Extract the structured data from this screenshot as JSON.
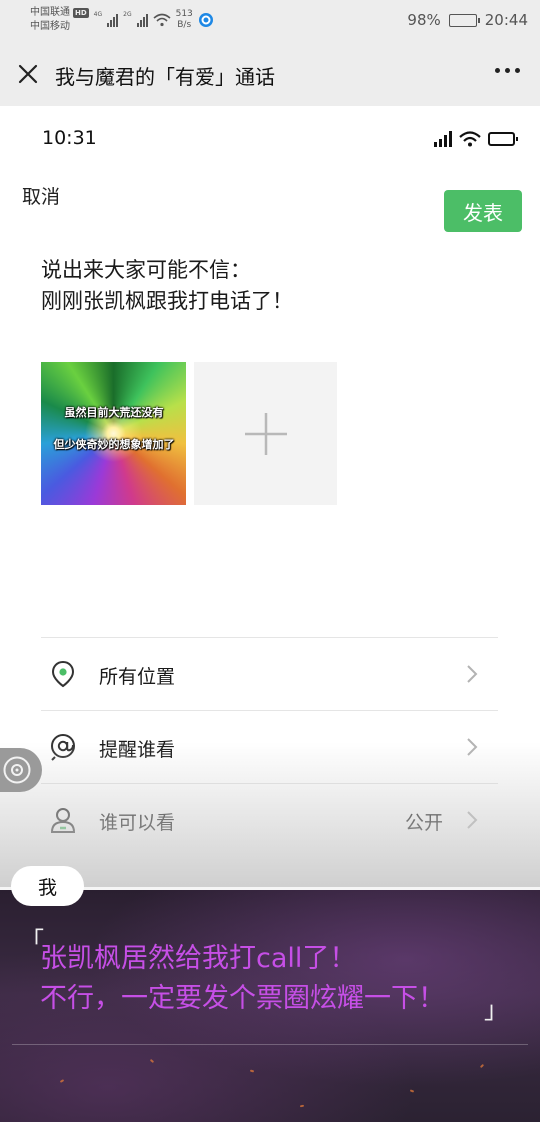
{
  "status_bar": {
    "carrier_1": "中国联通",
    "carrier_2": "中国移动",
    "hd_badge": "HD",
    "net_1": "4G",
    "net_2": "2G",
    "speed_value": "513",
    "speed_unit": "B/s",
    "battery": "98%",
    "battery_level": 0.98,
    "time": "20:44"
  },
  "app_bar": {
    "title": "我与魔君的「有爱」通话"
  },
  "inner_status": {
    "time": "10:31"
  },
  "composer": {
    "cancel": "取消",
    "publish": "发表",
    "text_line_1": "说出来大家可能不信：",
    "text_line_2": "刚刚张凯枫跟我打电话了！",
    "image_caption_1": "虽然目前大荒还没有",
    "image_caption_2": "但少侠奇妙的想象增加了"
  },
  "options": [
    {
      "icon": "location-pin-icon",
      "label": "所有位置",
      "value": ""
    },
    {
      "icon": "at-mention-icon",
      "label": "提醒谁看",
      "value": ""
    },
    {
      "icon": "person-icon",
      "label": "谁可以看",
      "value": "公开"
    }
  ],
  "dialogue": {
    "speaker": "我",
    "quote_open": "「",
    "line_1": "张凯枫居然给我打call了！",
    "line_2": "不行，一定要发个票圈炫耀一下！",
    "quote_close": "」"
  },
  "colors": {
    "publish_green": "#4cbe67",
    "dialogue_purple": "#c64fe6",
    "chrome_gray": "#ededed"
  }
}
